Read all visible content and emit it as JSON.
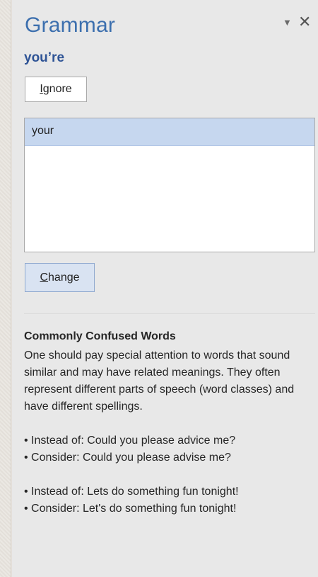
{
  "pane": {
    "title": "Grammar",
    "menu_icon": "dropdown-caret-icon",
    "close_icon": "close-icon"
  },
  "issue": {
    "flagged_text": "you’re"
  },
  "buttons": {
    "ignore_prefix": "I",
    "ignore_rest": "gnore",
    "change_prefix": "C",
    "change_rest": "hange"
  },
  "suggestions": [
    "your"
  ],
  "explanation": {
    "heading": "Commonly Confused Words",
    "body": "One should pay special attention to words that sound similar and may have related meanings. They often represent different parts of speech (word classes) and have different spellings.",
    "examples": [
      {
        "instead": "• Instead of: Could you please advice me?",
        "consider": "• Consider: Could you please advise me?"
      },
      {
        "instead": "• Instead of: Lets do something fun tonight!",
        "consider": "• Consider: Let's do something fun tonight!"
      }
    ]
  },
  "colors": {
    "title": "#3c6fae",
    "flagged": "#2f5496",
    "selection": "#c6d7ef"
  }
}
